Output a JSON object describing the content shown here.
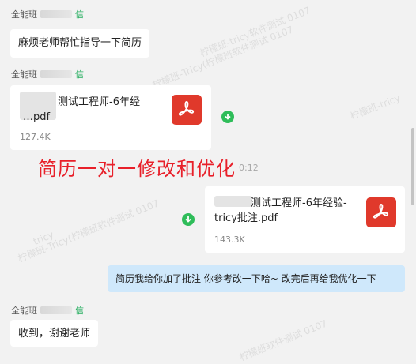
{
  "messages": [
    {
      "sender_prefix": "全能班",
      "sender_tag": "信",
      "text": "麻烦老师帮忙指导一下简历"
    },
    {
      "sender_prefix": "全能班",
      "sender_tag": "信",
      "file": {
        "name_line1": "测试工程师-6年经",
        "name_line2": "…pdf",
        "size": "127.4K",
        "icon": "pdf-icon",
        "download_icon": "download-icon"
      }
    },
    {
      "file": {
        "name_line1": "测试工程师-6年经验-",
        "name_line2": "tricy批注.pdf",
        "size": "143.3K",
        "icon": "pdf-icon",
        "download_icon": "download-icon"
      }
    },
    {
      "text": "简历我给你加了批注 你参考改一下哈~ 改完后再给我优化一下"
    },
    {
      "sender_prefix": "全能班",
      "sender_tag": "信",
      "text": "收到，谢谢老师"
    }
  ],
  "overlay": {
    "caption": "简历一对一修改和优化",
    "timestamp": "0:12"
  },
  "watermark": {
    "texts": [
      "柠檬班-tricy软件测试 0107",
      "柠檬班-Tricy(柠檬班软件测试 0107",
      "柠檬班-tricy",
      "柠檬班-Tricy(柠檬班软件测试 0107",
      "tricy",
      "柠檬班软件测试 0107"
    ]
  },
  "colors": {
    "background": "#f2f2f2",
    "bubble_other": "#ffffff",
    "bubble_me": "#cfe8fb",
    "caption": "#e8202a",
    "pdf": "#e0392b",
    "download": "#2fbd5a",
    "sender_tag": "#27ae60"
  }
}
